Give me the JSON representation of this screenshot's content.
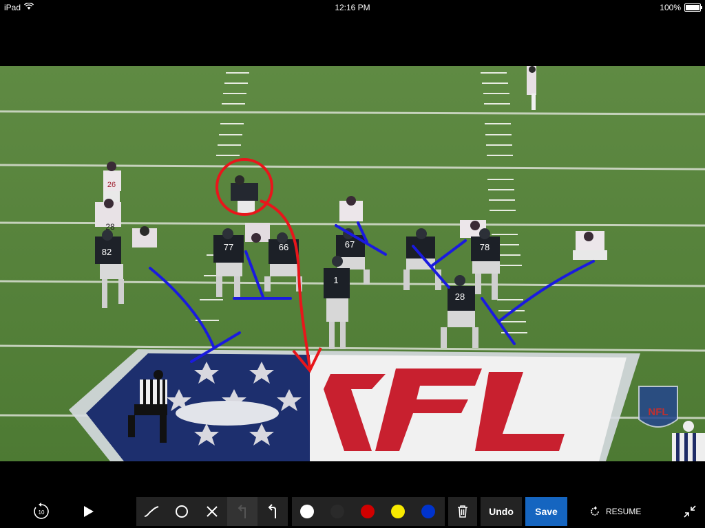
{
  "status_bar": {
    "device": "iPad",
    "time": "12:16 PM",
    "battery": "100%",
    "battery_level": 1.0
  },
  "video": {
    "jerseys": [
      "26",
      "28",
      "82",
      "77",
      "66",
      "67",
      "1",
      "78",
      "28"
    ],
    "field_logo": "NFL",
    "watermark": "NFL",
    "drawing_colors": {
      "red": "#e8161b",
      "blue": "#1a1adf"
    }
  },
  "toolbar": {
    "skip_back": "10",
    "draw_tools": [
      "freehand-line",
      "circle",
      "x-mark",
      "arrow-disabled",
      "arrow"
    ],
    "colors": [
      "#ffffff",
      "#2a2a2a",
      "#d00000",
      "#f7ea00",
      "#0033cc"
    ],
    "undo_label": "Undo",
    "save_label": "Save",
    "resume_label": "RESUME"
  }
}
